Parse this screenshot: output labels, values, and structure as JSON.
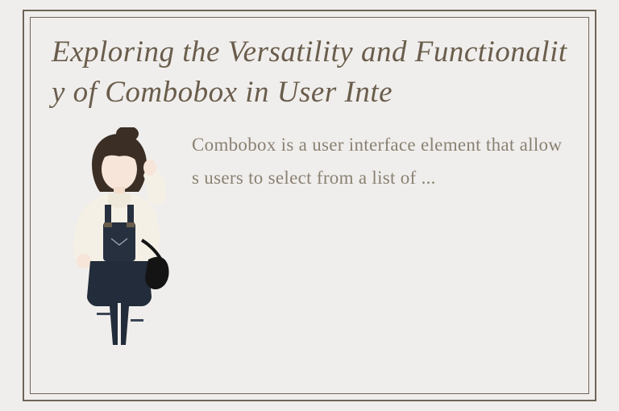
{
  "title": "Exploring the Versatility and Functionality of Combobox in User Inte",
  "body": "Combobox is a user interface element that allows users to select from a list of ...",
  "colors": {
    "frame": "#6f6458",
    "title": "#6a5d4c",
    "body": "#8a8173",
    "bg": "#f0eeec"
  }
}
